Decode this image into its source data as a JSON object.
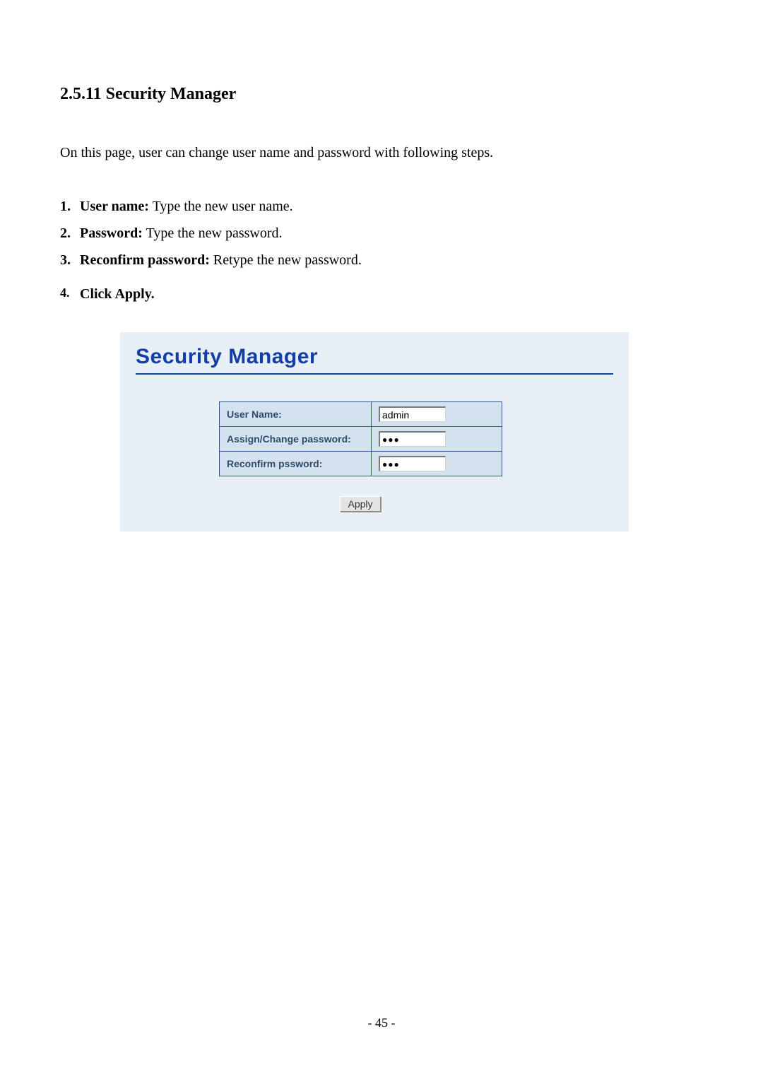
{
  "heading": "2.5.11 Security Manager",
  "intro": "On this page, user can change user name and password with following steps.",
  "steps": {
    "s1": {
      "num": "1.",
      "bold": "User name:",
      "rest": " Type the new user name."
    },
    "s2": {
      "num": "2.",
      "bold": "Password:",
      "rest": " Type the new password."
    },
    "s3": {
      "num": "3.",
      "bold": "Reconfirm password:",
      "rest": " Retype the new password."
    },
    "s4": {
      "num": "4.",
      "bold": "Click Apply.",
      "rest": ""
    }
  },
  "panel": {
    "title": "Security Manager",
    "rows": {
      "user": {
        "label": "User Name:",
        "value": "admin"
      },
      "pw": {
        "label": "Assign/Change password:",
        "value": "●●●"
      },
      "confirm": {
        "label": "Reconfirm pssword:",
        "value": "●●●"
      }
    },
    "apply_label": "Apply"
  },
  "page_number": "- 45 -"
}
